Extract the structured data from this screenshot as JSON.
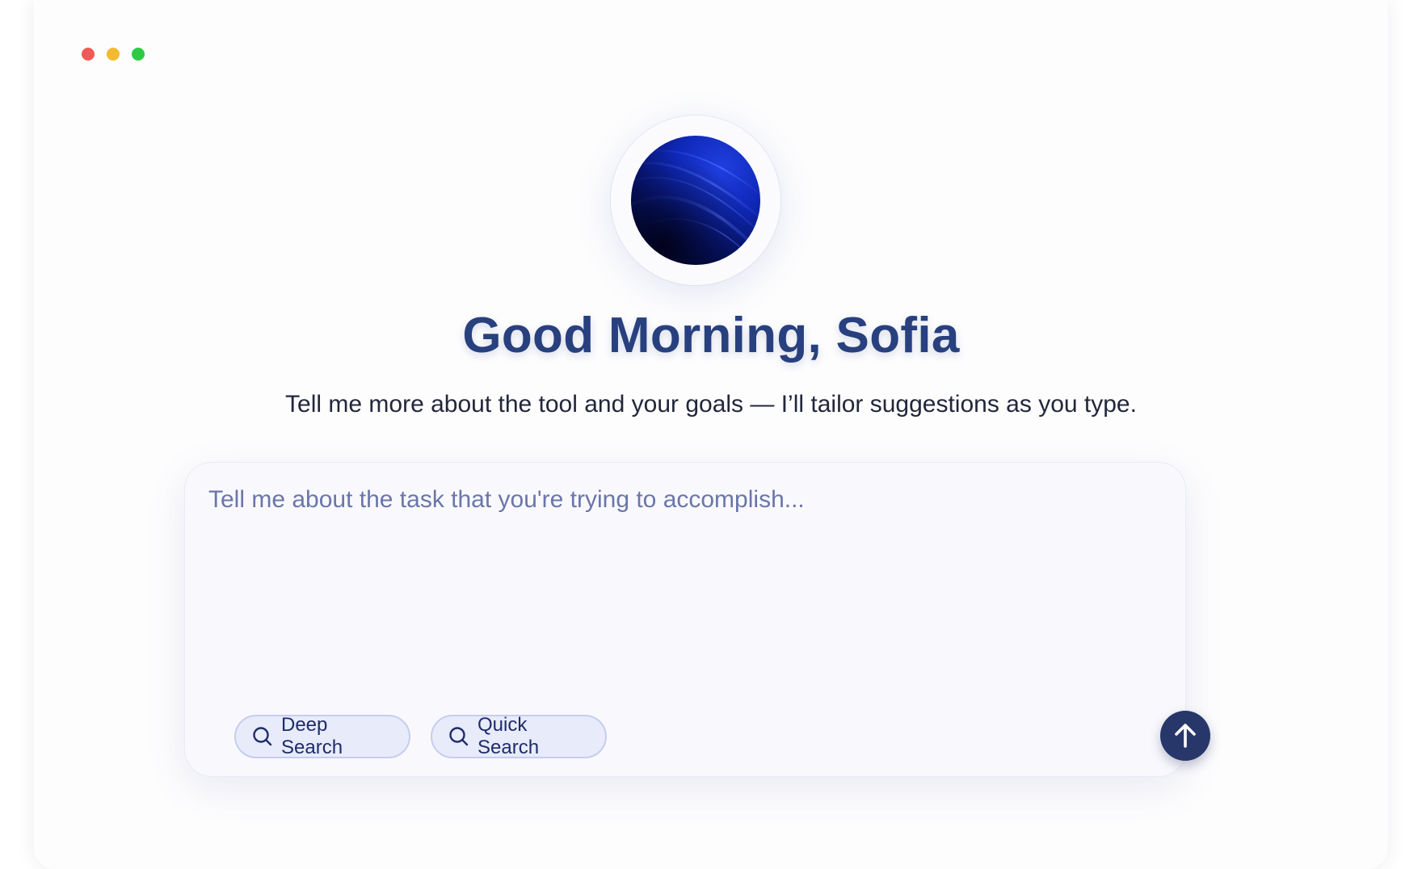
{
  "window": {
    "controls": [
      "close",
      "minimize",
      "zoom"
    ],
    "colors": {
      "close": "#ee5b57",
      "minimize": "#f3ba2f",
      "zoom": "#2dcb45"
    }
  },
  "avatar": {
    "icon": "abstract-blue-orb"
  },
  "greeting": "Good Morning, Sofia",
  "subtitle": "Tell me more about the tool and your goals — I’ll tailor suggestions as you type.",
  "composer": {
    "value": "",
    "placeholder": "Tell me about the task that you're trying to accomplish...",
    "actions": [
      {
        "label": "Deep Search",
        "icon": "search-icon"
      },
      {
        "label": "Quick Search",
        "icon": "search-icon"
      }
    ],
    "send_icon": "arrow-up-icon"
  },
  "colors": {
    "accent": "#28407e",
    "send_button": "#28376a",
    "chip_background": "#e8ebfa",
    "chip_border": "#c6cdee"
  }
}
